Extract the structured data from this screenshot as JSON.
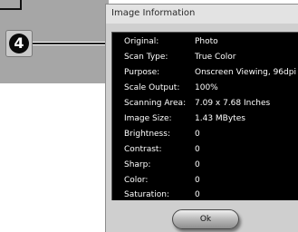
{
  "callout": {
    "step_number": "4"
  },
  "dialog": {
    "title": "Image Information",
    "ok_label": "Ok",
    "rows": [
      {
        "label": "Original:",
        "value": "Photo"
      },
      {
        "label": "Scan Type:",
        "value": "True Color"
      },
      {
        "label": "Purpose:",
        "value": "Onscreen Viewing, 96dpi"
      },
      {
        "label": "Scale Output:",
        "value": "100%"
      },
      {
        "label": "Scanning Area:",
        "value": "7.09 x 7.68 Inches"
      },
      {
        "label": "Image Size:",
        "value": "1.43 MBytes"
      },
      {
        "label": "Brightness:",
        "value": "0"
      },
      {
        "label": "Contrast:",
        "value": "0"
      },
      {
        "label": "Sharp:",
        "value": "0"
      },
      {
        "label": "Color:",
        "value": "0"
      },
      {
        "label": "Saturation:",
        "value": "0"
      }
    ]
  },
  "colors": {
    "panel_background": "#000000",
    "panel_text": "#ffffff",
    "dialog_background": "#cfcfcf"
  }
}
